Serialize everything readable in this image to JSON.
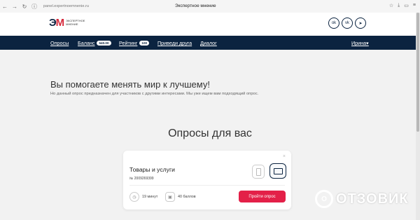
{
  "browser": {
    "url": "panel.expertnoemnenie.ru",
    "tab_title": "Экспертное мнение",
    "back_icon": "←",
    "forward_icon": "→",
    "reload_icon": "↻",
    "info_icon": "ⓘ"
  },
  "header": {
    "logo_text": "ЭКСПЕРТНОЕ МНЕНИЕ",
    "social": [
      "ok-icon",
      "vk-icon",
      "telegram-icon"
    ]
  },
  "nav": {
    "surveys": "Опросы",
    "balance": "Баланс",
    "balance_value": "640.00",
    "rating": "Рейтинг",
    "rating_value": "100",
    "invite": "Приведи друга",
    "dialog": "Диалог",
    "user": "Ирина▾"
  },
  "main": {
    "headline": "Вы помогаете менять мир к лучшему!",
    "subline": "Но данный опрос предназначен для участников с другими интересами. Мы уже ищем вам подходящий опрос.",
    "section_title": "Опросы для вас"
  },
  "card": {
    "close": "×",
    "title": "Товары и услуги",
    "id": "№ 2009269399",
    "duration": "19 минут",
    "points": "40 баллов",
    "cta": "Пройти опрос"
  },
  "watermark": {
    "letter": "О",
    "text": "ОТЗОВИК"
  },
  "colors": {
    "brand_navy": "#0b2340",
    "accent_red": "#e32048"
  }
}
